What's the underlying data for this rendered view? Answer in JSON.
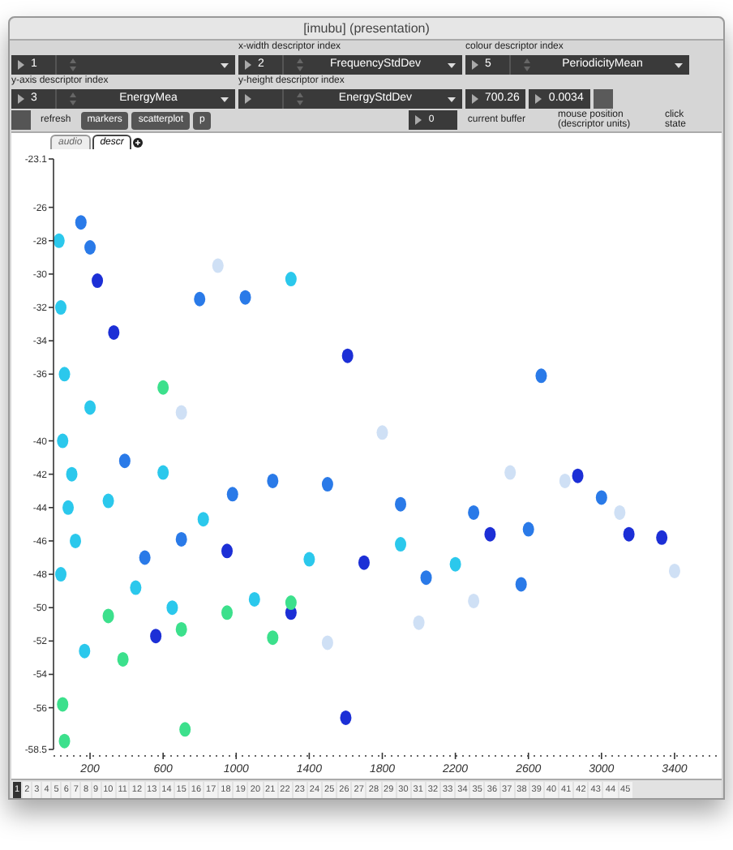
{
  "window": {
    "title": "[imubu] (presentation)"
  },
  "selector_rows": [
    [
      {
        "number": "1"
      },
      {
        "label": "x-width descriptor index",
        "number": "2",
        "value": "FrequencyStdDev"
      },
      {
        "label": "colour descriptor index",
        "number": "5",
        "value": "PeriodicityMean"
      }
    ],
    [
      {
        "label": "y-axis descriptor index",
        "number": "3",
        "value": "EnergyMea"
      },
      {
        "label": "y-height descriptor index",
        "value": "EnergyStdDev"
      }
    ]
  ],
  "readouts": [
    "700.26",
    "0.0034"
  ],
  "toolbar": [
    {
      "kind": "square"
    },
    {
      "kind": "text",
      "text": "refresh"
    },
    {
      "kind": "button",
      "text": "markers"
    },
    {
      "kind": "button",
      "text": "scatterplot"
    },
    {
      "kind": "button",
      "text": "p"
    },
    {
      "kind": "number",
      "text": "0"
    },
    {
      "kind": "text",
      "text": "current buffer"
    }
  ],
  "captions": [
    "mouse position (descriptor units)",
    "click state"
  ],
  "tabs": [
    {
      "label": "audio",
      "selected": false
    },
    {
      "label": "descr",
      "selected": true
    }
  ],
  "plot": {
    "chart_data": {
      "type": "scatter",
      "xlim": [
        0,
        3640
      ],
      "ylim": [
        -58.5,
        -23.1
      ],
      "xticks": [
        200,
        600,
        1000,
        1400,
        1800,
        2200,
        2600,
        3000,
        3400
      ],
      "yticks": [
        -23.1,
        -26,
        -28,
        -30,
        -32,
        -34,
        -36,
        -40,
        -42,
        -44,
        -46,
        -48,
        -50,
        -52,
        -54,
        -56,
        -58.5
      ],
      "series": [
        {
          "color": "#1c2fd6",
          "x": [
            1610,
            2390,
            1700,
            2870,
            3150,
            3330,
            1300,
            560,
            240,
            330,
            950,
            1600
          ],
          "values": [
            -34.9,
            -45.6,
            -47.3,
            -42.1,
            -45.6,
            -45.8,
            -50.3,
            -51.7,
            -30.4,
            -33.5,
            -46.6,
            -56.6
          ]
        },
        {
          "color": "#2a7ae8",
          "x": [
            3000,
            2600,
            2300,
            1900,
            1500,
            1200,
            980,
            700,
            500,
            390,
            800,
            1050,
            2670,
            2040,
            2560,
            150,
            200
          ],
          "values": [
            -43.4,
            -45.3,
            -44.3,
            -43.8,
            -42.6,
            -42.4,
            -43.2,
            -45.9,
            -47,
            -41.2,
            -31.5,
            -31.4,
            -36.1,
            -48.2,
            -48.6,
            -26.9,
            -28.4
          ]
        },
        {
          "color": "#2bc8ec",
          "x": [
            1400,
            1100,
            820,
            600,
            300,
            450,
            650,
            1900,
            2200,
            170,
            1300,
            200,
            30,
            40,
            60,
            50,
            80,
            40,
            100,
            120
          ],
          "values": [
            -47.1,
            -49.5,
            -44.7,
            -41.9,
            -43.6,
            -48.8,
            -50,
            -46.2,
            -47.4,
            -52.6,
            -30.3,
            -38,
            -28,
            -32,
            -36,
            -40,
            -44,
            -48,
            -42,
            -46
          ]
        },
        {
          "color": "#3ce08c",
          "x": [
            600,
            1300,
            950,
            700,
            380,
            300,
            1200,
            50,
            60,
            720
          ],
          "values": [
            -36.8,
            -49.7,
            -50.3,
            -51.3,
            -53.1,
            -50.5,
            -51.8,
            -55.8,
            -58,
            -57.3
          ]
        },
        {
          "color": "#cfe0f5",
          "x": [
            3400,
            2800,
            3100,
            2000,
            2300,
            1500,
            900,
            1800,
            2500,
            700
          ],
          "values": [
            -47.8,
            -42.4,
            -44.3,
            -50.9,
            -49.6,
            -52.1,
            -29.5,
            -39.5,
            -41.9,
            -38.3
          ]
        }
      ]
    }
  },
  "buffers": [
    {
      "label": "1",
      "selected": true
    },
    {
      "label": "2",
      "selected": false
    },
    {
      "label": "3",
      "selected": false
    },
    {
      "label": "4",
      "selected": false
    },
    {
      "label": "5",
      "selected": false
    },
    {
      "label": "6",
      "selected": false
    },
    {
      "label": "7",
      "selected": false
    },
    {
      "label": "8",
      "selected": false
    },
    {
      "label": "9",
      "selected": false
    },
    {
      "label": "10",
      "selected": false
    },
    {
      "label": "11",
      "selected": false
    },
    {
      "label": "12",
      "selected": false
    },
    {
      "label": "13",
      "selected": false
    },
    {
      "label": "14",
      "selected": false
    },
    {
      "label": "15",
      "selected": false
    },
    {
      "label": "16",
      "selected": false
    },
    {
      "label": "17",
      "selected": false
    },
    {
      "label": "18",
      "selected": false
    },
    {
      "label": "19",
      "selected": false
    },
    {
      "label": "20",
      "selected": false
    },
    {
      "label": "21",
      "selected": false
    },
    {
      "label": "22",
      "selected": false
    },
    {
      "label": "23",
      "selected": false
    },
    {
      "label": "24",
      "selected": false
    },
    {
      "label": "25",
      "selected": false
    },
    {
      "label": "26",
      "selected": false
    },
    {
      "label": "27",
      "selected": false
    },
    {
      "label": "28",
      "selected": false
    },
    {
      "label": "29",
      "selected": false
    },
    {
      "label": "30",
      "selected": false
    },
    {
      "label": "31",
      "selected": false
    },
    {
      "label": "32",
      "selected": false
    },
    {
      "label": "33",
      "selected": false
    },
    {
      "label": "34",
      "selected": false
    },
    {
      "label": "35",
      "selected": false
    },
    {
      "label": "36",
      "selected": false
    },
    {
      "label": "37",
      "selected": false
    },
    {
      "label": "38",
      "selected": false
    },
    {
      "label": "39",
      "selected": false
    },
    {
      "label": "40",
      "selected": false
    },
    {
      "label": "41",
      "selected": false
    },
    {
      "label": "42",
      "selected": false
    },
    {
      "label": "43",
      "selected": false
    },
    {
      "label": "44",
      "selected": false
    },
    {
      "label": "45",
      "selected": false
    }
  ]
}
